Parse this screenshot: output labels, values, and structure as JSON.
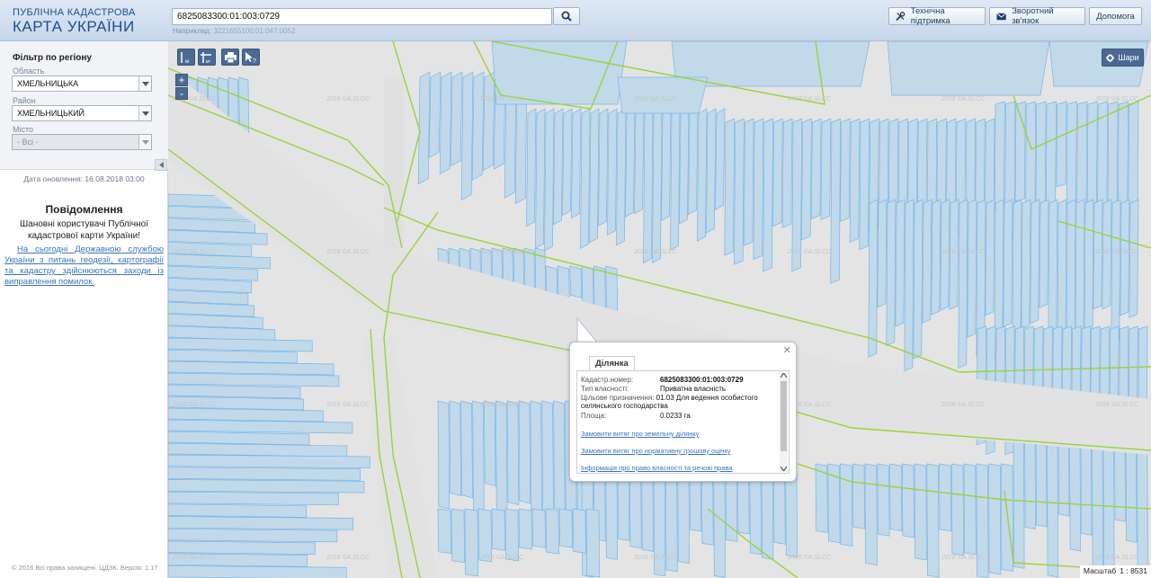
{
  "header": {
    "logo_line1": "ПУБЛІЧНА КАДАСТРОВА",
    "logo_line2": "КАРТА УКРАЇНИ",
    "search_value": "6825083300:01:003:0729",
    "example_label": "Наприклад:",
    "example_value": "3221655100:01:047:0052",
    "buttons": {
      "support": "Технічна підтримка",
      "feedback": "Зворотний зв'язок",
      "help": "Допомога"
    }
  },
  "sidebar": {
    "filter_title": "Фільтр по регіону",
    "region_label": "Область",
    "region_value": "ХМЕЛЬНИЦЬКА",
    "district_label": "Район",
    "district_value": "ХМЕЛЬНИЦЬКИЙ",
    "city_label": "Місто",
    "city_value": "- Всі -",
    "update_date": "Дата оновлення: 16.08.2018 03:00",
    "notice_title": "Повідомлення",
    "notice_greeting": "Шановні користувачі Публічної кадастрової карти України!",
    "notice_link": "На сьогодні Державною службою України з питань геодезії, картографії та кадастру здійснюються заходи із виправлення помилок.",
    "copyright": "© 2016 Всі права захищені. ЦДЗК. Версія: 1.17"
  },
  "map": {
    "toolbar": {
      "measure_length_label": "м",
      "measure_area_label": "м²"
    },
    "zoom_in": "+",
    "zoom_out": "-",
    "layers_label": "Шари",
    "watermark": "2018 ©A.SLCC",
    "scale_label": "Масштаб",
    "scale_value": "1 : 8531",
    "colors": {
      "parcel_fill": "#c2d9ea",
      "parcel_stroke": "#74b6e8",
      "boundary": "#9ad23b",
      "map_bg": "#e4e4e4"
    }
  },
  "popup": {
    "tab": "Ділянка",
    "fields": [
      {
        "key": "Кадастр.номер:",
        "value": "6825083300:01:003:0729"
      },
      {
        "key": "Тип власності:",
        "value": "Приватна власність"
      },
      {
        "key": "Цільове призначення:",
        "value": "01.03 Для ведення особистого селянського господарства"
      },
      {
        "key": "Площа:",
        "value": "0.0233 га"
      }
    ],
    "links": [
      "Замовити витяг про земельну ділянку",
      "Замовити витяг про нормативну грошову оцінку",
      "Інформація про право власності та речові права"
    ]
  }
}
